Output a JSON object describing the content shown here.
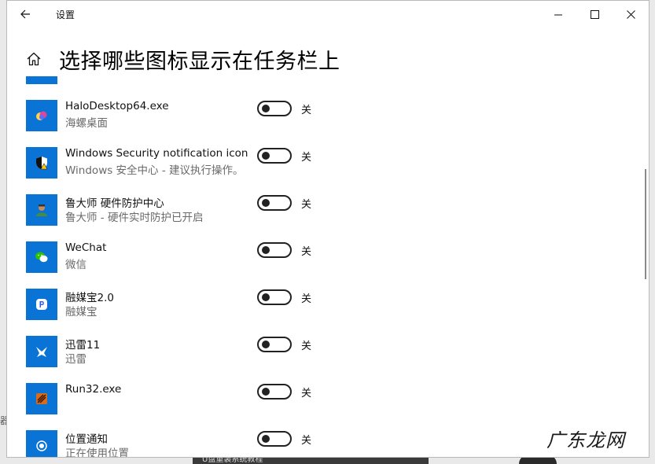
{
  "window": {
    "title": "设置",
    "minimize_icon": "minimize-icon",
    "maximize_icon": "maximize-icon",
    "close_icon": "close-icon"
  },
  "page": {
    "title": "选择哪些图标显示在任务栏上"
  },
  "apps": [
    {
      "name": "",
      "desc": "",
      "state": "关",
      "icon": "app-icon",
      "partial": true
    },
    {
      "name": "HaloDesktop64.exe",
      "desc": "海螺桌面",
      "state": "关",
      "icon": "halodesktop-icon",
      "color": "#0a74d6"
    },
    {
      "name": "Windows Security notification icon",
      "desc": "Windows 安全中心 - 建议执行操作。",
      "state": "关",
      "icon": "shield-warning-icon",
      "color": "#0a74d6"
    },
    {
      "name": "鲁大师 硬件防护中心",
      "desc": "鲁大师 - 硬件实时防护已开启",
      "state": "关",
      "icon": "ludashi-icon",
      "color": "#0a74d6"
    },
    {
      "name": "WeChat",
      "desc": "微信",
      "state": "关",
      "icon": "wechat-icon",
      "color": "#0a74d6"
    },
    {
      "name": "融媒宝2.0",
      "desc": "融媒宝",
      "state": "关",
      "icon": "rongmeibao-icon",
      "color": "#0a74d6"
    },
    {
      "name": "迅雷11",
      "desc": "迅雷",
      "state": "关",
      "icon": "xunlei-icon",
      "color": "#0a74d6"
    },
    {
      "name": "Run32.exe",
      "desc": "",
      "state": "关",
      "icon": "run32-icon",
      "color": "#0a74d6"
    },
    {
      "name": "位置通知",
      "desc": "正在使用位置",
      "state": "关",
      "icon": "location-icon",
      "color": "#0a74d6"
    }
  ],
  "background": {
    "bottom_caption": "U盘重装系统教程",
    "watermark": "广东龙网"
  }
}
